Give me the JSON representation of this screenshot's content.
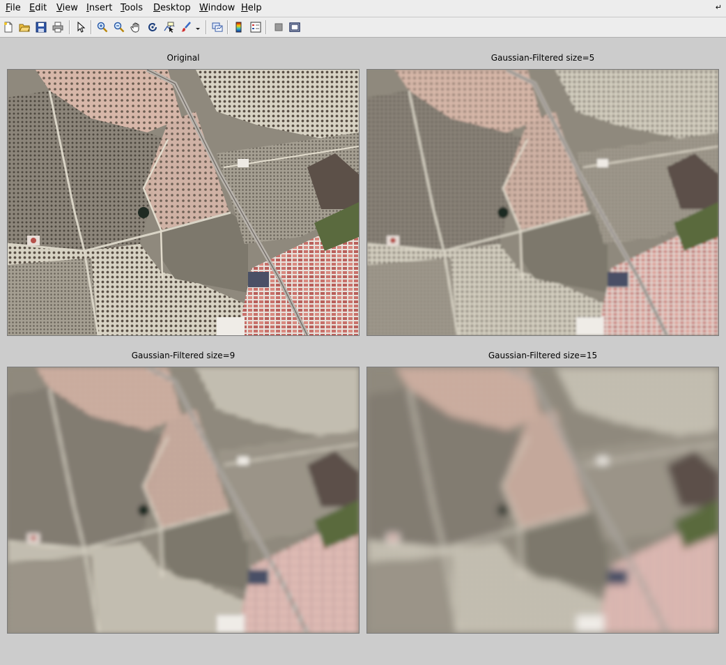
{
  "window": {
    "menus": [
      {
        "label": "File",
        "key": "F",
        "rest": "ile"
      },
      {
        "label": "Edit",
        "key": "E",
        "rest": "dit"
      },
      {
        "label": "View",
        "key": "V",
        "rest": "iew"
      },
      {
        "label": "Insert",
        "key": "I",
        "rest": "nsert"
      },
      {
        "label": "Tools",
        "key": "T",
        "rest": "ools"
      },
      {
        "label": "Desktop",
        "key": "D",
        "rest": "esktop"
      },
      {
        "label": "Window",
        "key": "W",
        "rest": "indow"
      },
      {
        "label": "Help",
        "key": "H",
        "rest": "elp"
      }
    ],
    "dock_icon": "dock-arrow-icon"
  },
  "toolbar": {
    "buttons": [
      "new-figure-icon",
      "open-file-icon",
      "save-icon",
      "print-icon",
      "select-arrow-icon",
      "zoom-in-icon",
      "zoom-out-icon",
      "pan-hand-icon",
      "rotate-3d-icon",
      "data-cursor-icon",
      "brush-icon",
      "brush-dropdown-icon",
      "link-plot-icon",
      "colorbar-icon",
      "legend-icon",
      "hide-plot-tools-icon",
      "show-plot-tools-icon"
    ]
  },
  "panels": [
    {
      "title": "Original",
      "blur": 0
    },
    {
      "title": "Gaussian-Filtered size=5",
      "blur": 1.6
    },
    {
      "title": "Gaussian-Filtered size=9",
      "blur": 3.2
    },
    {
      "title": "Gaussian-Filtered size=15",
      "blur": 5.5
    }
  ],
  "colors": {
    "figure_bg": "#cccccc",
    "menubar_bg": "#ededed",
    "field_dark": "#7b756a",
    "field_light": "#d8d3c4",
    "soil_pink": "#d7b7a9",
    "roof_red": "#c8706a",
    "road": "#b9b4ad"
  }
}
